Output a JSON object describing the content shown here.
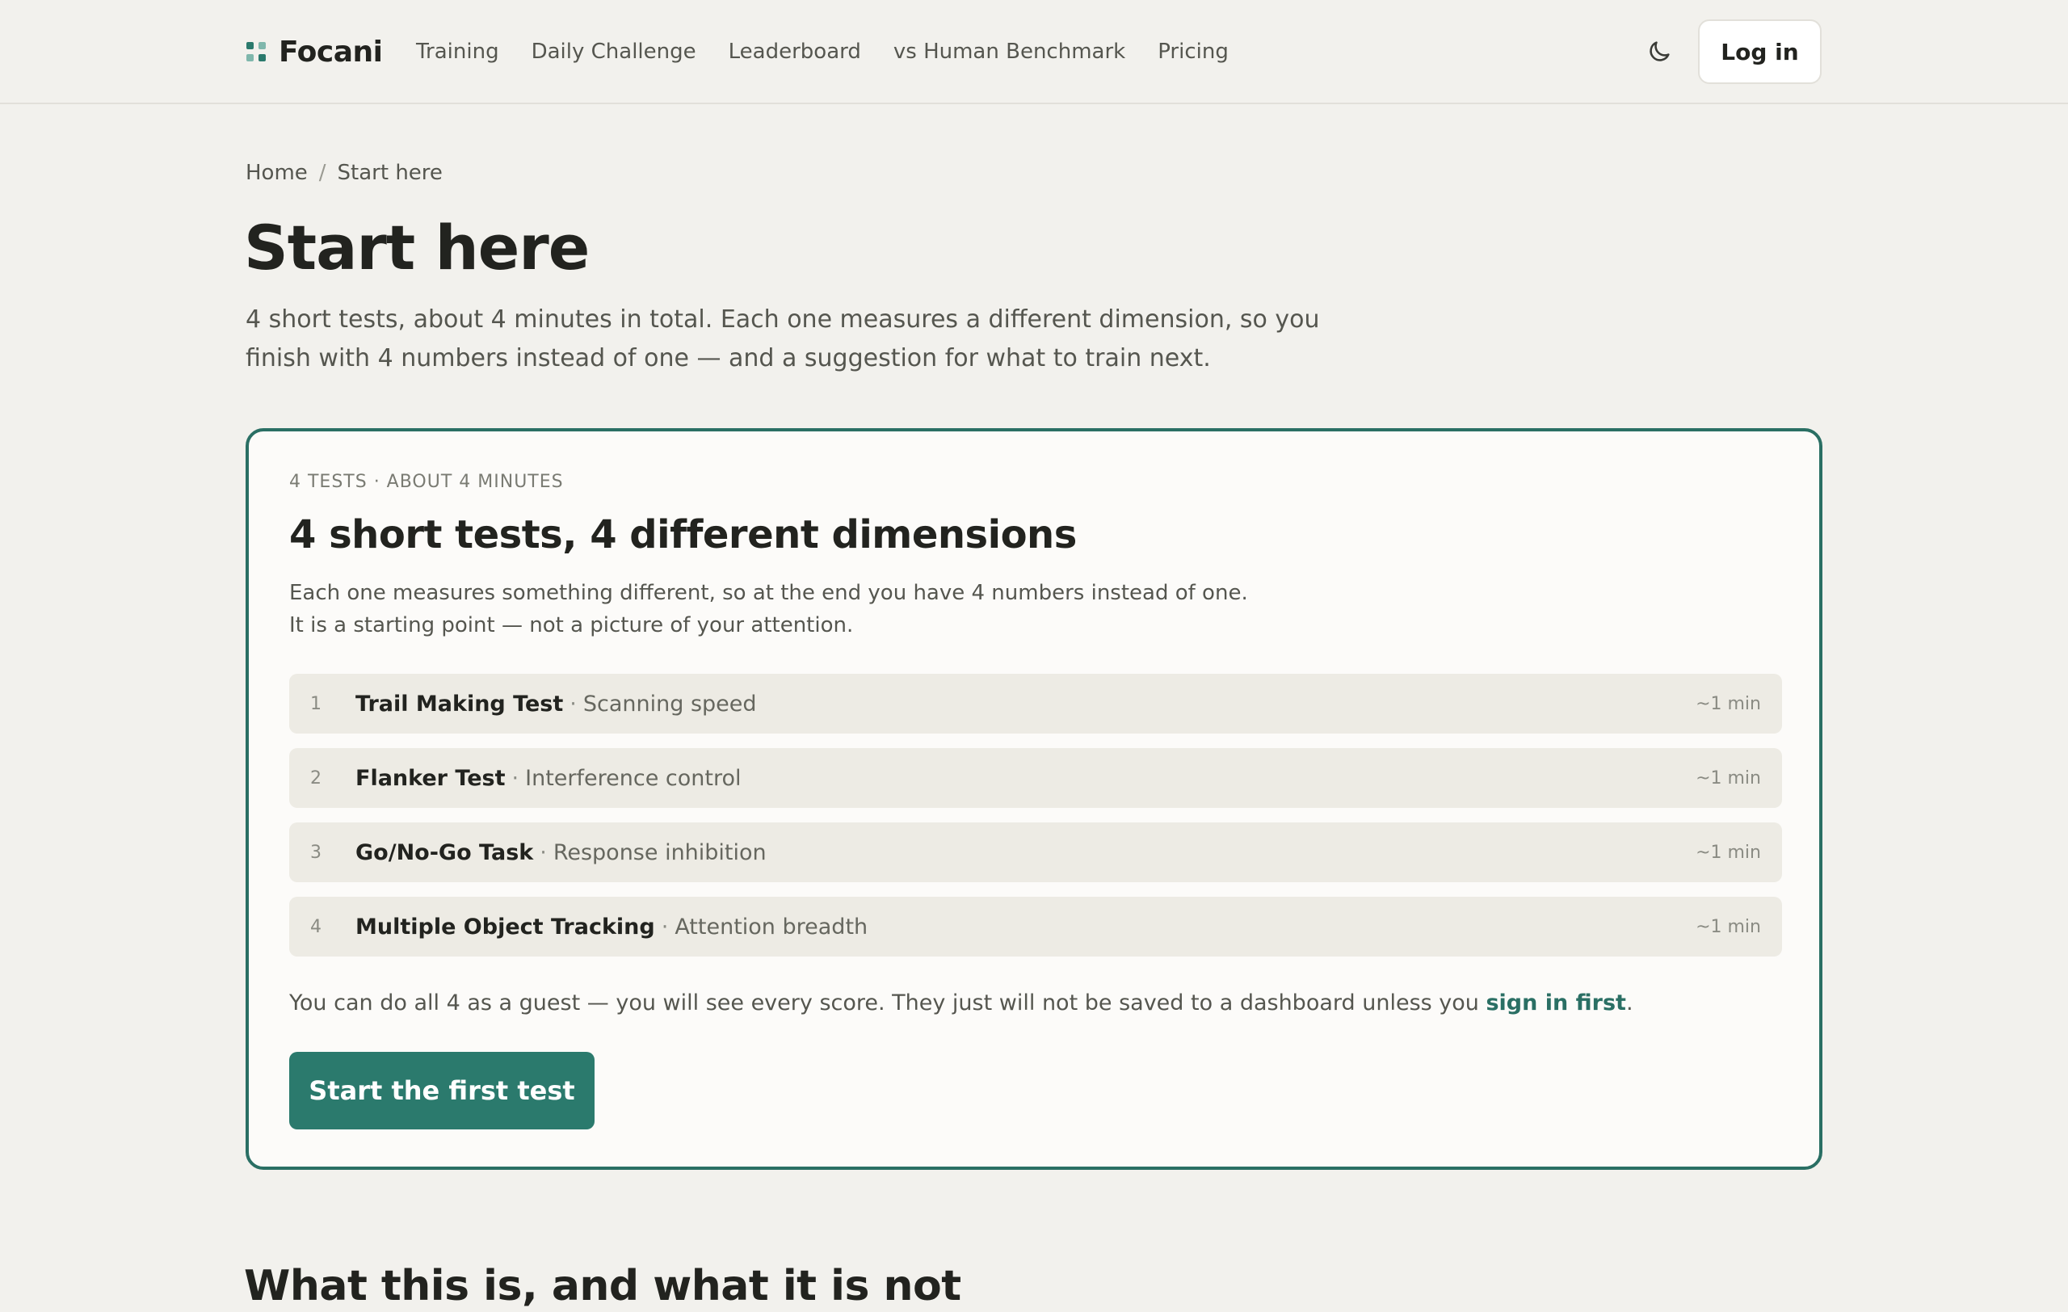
{
  "header": {
    "brand": "Focani",
    "nav": [
      {
        "label": "Training"
      },
      {
        "label": "Daily Challenge"
      },
      {
        "label": "Leaderboard"
      },
      {
        "label": "vs Human Benchmark"
      },
      {
        "label": "Pricing"
      }
    ],
    "theme_icon": "moon-icon",
    "login_label": "Log in"
  },
  "breadcrumb": {
    "home": "Home",
    "separator": "/",
    "current": "Start here"
  },
  "page": {
    "title": "Start here",
    "subtitle": "4 short tests, about 4 minutes in total. Each one measures a different dimension, so you finish with 4 numbers instead of one — and a suggestion for what to train next."
  },
  "card": {
    "eyebrow": "4 TESTS · ABOUT 4 MINUTES",
    "title": "4 short tests, 4 different dimensions",
    "description": "Each one measures something different, so at the end you have 4 numbers instead of one. It is a starting point — not a picture of your attention.",
    "tests": [
      {
        "num": "1",
        "name": "Trail Making Test",
        "dot": "·",
        "dimension": "Scanning speed",
        "time": "~1 min"
      },
      {
        "num": "2",
        "name": "Flanker Test",
        "dot": "·",
        "dimension": "Interference control",
        "time": "~1 min"
      },
      {
        "num": "3",
        "name": "Go/No-Go Task",
        "dot": "·",
        "dimension": "Response inhibition",
        "time": "~1 min"
      },
      {
        "num": "4",
        "name": "Multiple Object Tracking",
        "dot": "·",
        "dimension": "Attention breadth",
        "time": "~1 min"
      }
    ],
    "guest_note": "You can do all 4 as a guest — you will see every score. They just will not be saved to a dashboard unless you ",
    "guest_link": "sign in first",
    "guest_end": ".",
    "cta_label": "Start the first test"
  },
  "next_section": {
    "heading": "What this is, and what it is not"
  },
  "colors": {
    "accent": "#2b7a6d",
    "background": "#f2f1ed",
    "card_border": "#2a6f64"
  }
}
